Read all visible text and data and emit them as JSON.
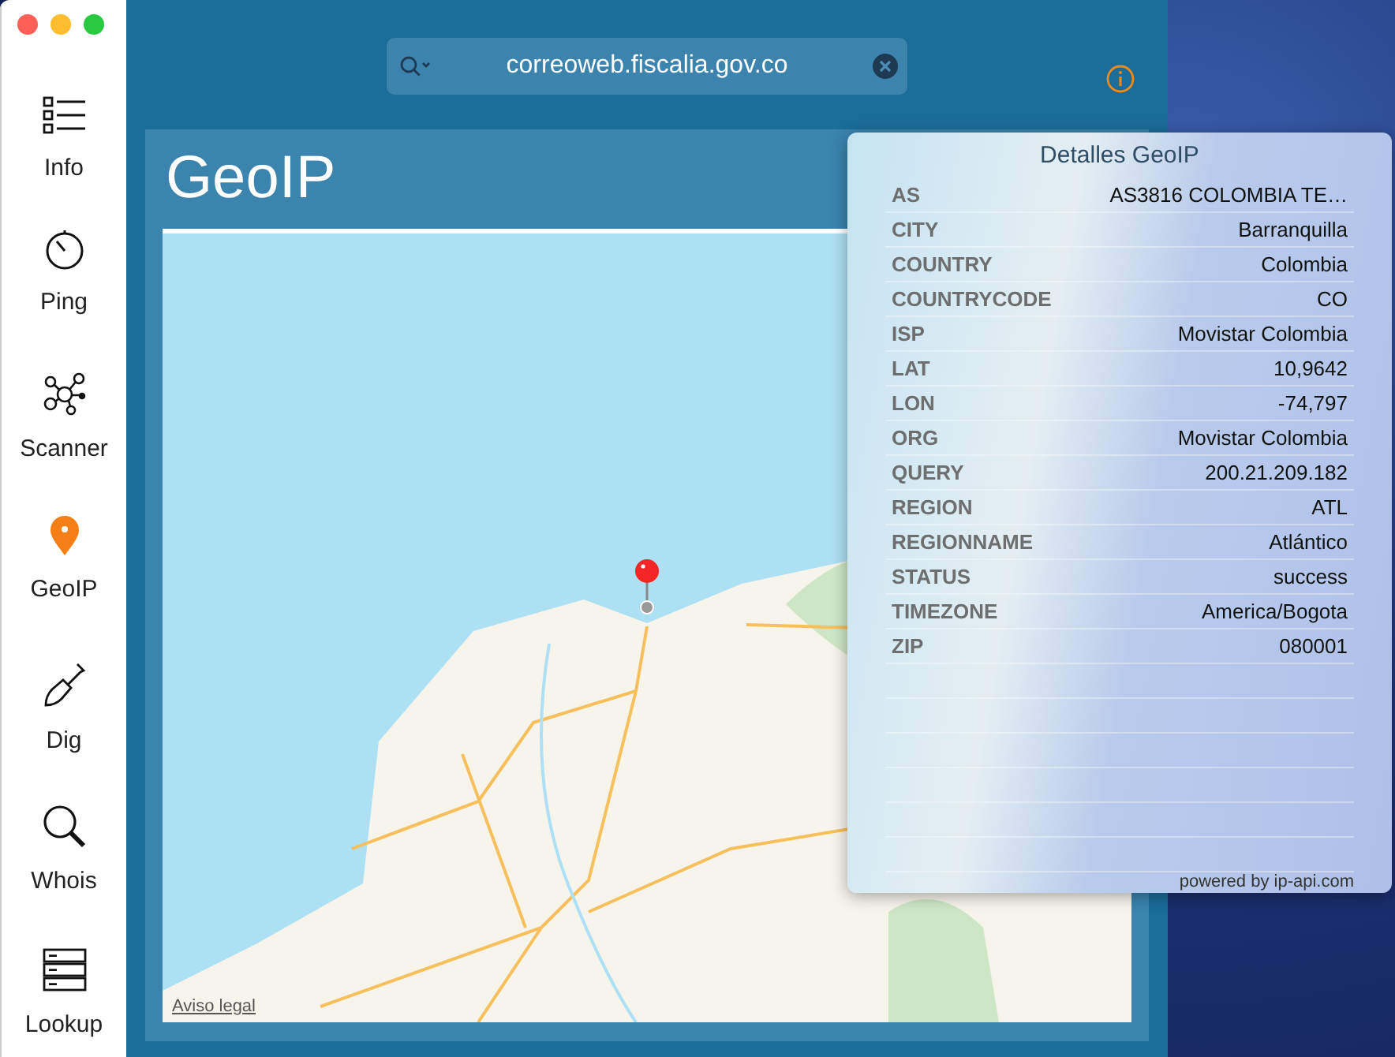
{
  "sidebar": {
    "items": [
      {
        "label": "Info",
        "selected": false
      },
      {
        "label": "Ping",
        "selected": false
      },
      {
        "label": "Scanner",
        "selected": false
      },
      {
        "label": "GeoIP",
        "selected": true
      },
      {
        "label": "Dig",
        "selected": false
      },
      {
        "label": "Whois",
        "selected": false
      },
      {
        "label": "Lookup",
        "selected": false
      }
    ]
  },
  "search": {
    "value": "correoweb.fiscalia.gov.co"
  },
  "panel": {
    "title": "GeoIP",
    "map": {
      "legal_link": "Aviso legal"
    }
  },
  "popover": {
    "title": "Detalles GeoIP",
    "rows": [
      {
        "key": "AS",
        "value": "AS3816 COLOMBIA TE…"
      },
      {
        "key": "CITY",
        "value": "Barranquilla"
      },
      {
        "key": "COUNTRY",
        "value": "Colombia"
      },
      {
        "key": "COUNTRYCODE",
        "value": "CO"
      },
      {
        "key": "ISP",
        "value": "Movistar Colombia"
      },
      {
        "key": "LAT",
        "value": "10,9642"
      },
      {
        "key": "LON",
        "value": "-74,797"
      },
      {
        "key": "ORG",
        "value": "Movistar Colombia"
      },
      {
        "key": "QUERY",
        "value": "200.21.209.182"
      },
      {
        "key": "REGION",
        "value": "ATL"
      },
      {
        "key": "REGIONNAME",
        "value": "Atlántico"
      },
      {
        "key": "STATUS",
        "value": "success"
      },
      {
        "key": "TIMEZONE",
        "value": "America/Bogota"
      },
      {
        "key": "ZIP",
        "value": "080001"
      }
    ],
    "footer": "powered by ip-api.com"
  }
}
